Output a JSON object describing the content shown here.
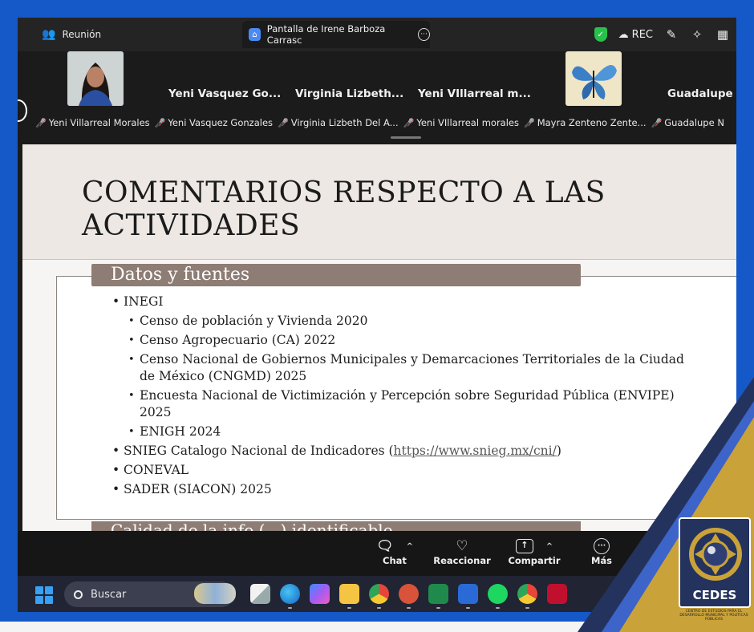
{
  "window": {
    "meeting_tab": "Reunión",
    "share_tab": "Pantalla de Irene Barboza Carrasc",
    "rec_label": "REC"
  },
  "participants": {
    "big_names": [
      "Yeni Vasquez Go...",
      "Virginia  Lizbeth...",
      "Yeni VIllarreal m...",
      "Guadalupe I"
    ],
    "name_labels": [
      "Yeni Villarreal Morales",
      "Yeni Vasquez Gonzales",
      "Virginia Lizbeth Del A...",
      "Yeni VIllarreal morales",
      "Mayra Zenteno Zente...",
      "Guadalupe N"
    ]
  },
  "slide": {
    "title": "COMENTARIOS RESPECTO A LAS ACTIVIDADES",
    "section_label": "Datos y fuentes",
    "items": [
      {
        "level": 1,
        "text": "INEGI"
      },
      {
        "level": 2,
        "text": "Censo de población y Vivienda 2020"
      },
      {
        "level": 2,
        "text": "Censo Agropecuario (CA) 2022"
      },
      {
        "level": 2,
        "text": "Censo Nacional de Gobiernos Municipales y Demarcaciones Territoriales de la Ciudad de México (CNGMD) 2025"
      },
      {
        "level": 2,
        "text": "Encuesta Nacional de Victimización y Percepción sobre Seguridad Pública (ENVIPE) 2025"
      },
      {
        "level": 2,
        "text": "ENIGH 2024"
      }
    ],
    "snieg_prefix": "SNIEG Catalogo Nacional de Indicadores (",
    "snieg_link": "https://www.snieg.mx/cni/",
    "snieg_suffix": ")",
    "items_after": [
      "CONEVAL",
      "SADER (SIACON) 2025"
    ],
    "next_section_partial": "Calidad de la info (...) identificable"
  },
  "toolbar": {
    "chat": "Chat",
    "react": "Reaccionar",
    "share": "Compartir",
    "more": "Más"
  },
  "taskbar": {
    "search_placeholder": "Buscar"
  },
  "overlay": {
    "logo_text": "CEDES",
    "logo_subtitle": "CENTRO DE ESTUDIOS PARA EL DESARROLLO MUNICIPAL Y POLÍTICAS PÚBLICAS",
    "accent_gold": "#c9a23a",
    "accent_navy": "#24335e",
    "frame_blue": "#1558c8"
  }
}
